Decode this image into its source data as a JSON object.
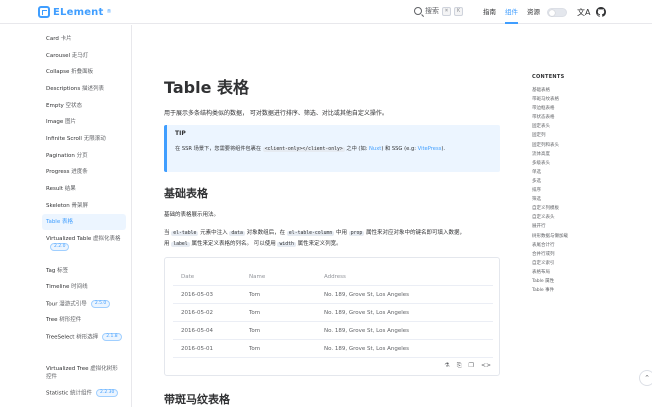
{
  "header": {
    "logo_text": "ELement",
    "logo_sup": "®",
    "search_label": "搜索",
    "kbd_keys": [
      "⌘",
      "K"
    ],
    "nav": [
      {
        "label": "指南",
        "active": false
      },
      {
        "label": "组件",
        "active": true
      },
      {
        "label": "资源",
        "active": false
      }
    ],
    "lang_icon": "文A"
  },
  "sidebar": {
    "items": [
      {
        "label": "Card",
        "sub": "卡片"
      },
      {
        "label": "Carousel",
        "sub": "走马灯"
      },
      {
        "label": "Collapse",
        "sub": "折叠面板"
      },
      {
        "label": "Descriptions",
        "sub": "描述列表"
      },
      {
        "label": "Empty",
        "sub": "空状态"
      },
      {
        "label": "Image",
        "sub": "图片"
      },
      {
        "label": "Infinite Scroll",
        "sub": "无限滚动"
      },
      {
        "label": "Pagination",
        "sub": "分页"
      },
      {
        "label": "Progress",
        "sub": "进度条"
      },
      {
        "label": "Result",
        "sub": "结果"
      },
      {
        "label": "Skeleton",
        "sub": "骨架屏"
      },
      {
        "label": "Table",
        "sub": "表格",
        "active": true
      },
      {
        "label": "Virtualized Table",
        "sub": "虚拟化表格",
        "badge": "2.2.0"
      },
      {
        "label": "Tag",
        "sub": "标签"
      },
      {
        "label": "Timeline",
        "sub": "时间线"
      },
      {
        "label": "Tour",
        "sub": "漫游式引导",
        "badge": "2.5.0"
      },
      {
        "label": "Tree",
        "sub": "树形控件"
      },
      {
        "label": "TreeSelect",
        "sub": "树形选择",
        "badge": "2.1.8"
      },
      {
        "label": "Virtualized Tree",
        "sub": "虚拟化树形控件"
      },
      {
        "label": "Statistic",
        "sub": "统计组件",
        "badge": "2.2.30"
      }
    ]
  },
  "main": {
    "title": "Table 表格",
    "intro": "用于展示多条结构类似的数据， 可对数据进行排序、筛选、对比或其他自定义操作。",
    "tip": {
      "title": "TIP",
      "text_before": "在 SSR 场景下，您需要将组件包裹在 ",
      "code": "<client-only></client-only>",
      "text_mid": " 之中 (如: ",
      "link1": "Nuxt",
      "text_mid2": ") 和 SSG (e.g: ",
      "link2": "VitePress",
      "text_after": ")."
    },
    "basic": {
      "title": "基础表格",
      "subtitle": "基础的表格展示用法。",
      "p_1": "当 ",
      "c_1": "el-table",
      "p_2": " 元素中注入 ",
      "c_2": "data",
      "p_3": " 对象数组后，在 ",
      "c_3": "el-table-column",
      "p_4": " 中用 ",
      "c_4": "prop",
      "p_5": " 属性来对应对象中的键名即可填入数据，",
      "p_6": "用 ",
      "c_5": "label",
      "p_7": " 属性来定义表格的列名。 可以使用 ",
      "c_6": "width",
      "p_8": " 属性来定义列宽。"
    },
    "table": {
      "headers": [
        "Date",
        "Name",
        "Address"
      ],
      "rows": [
        [
          "2016-05-03",
          "Tom",
          "No. 189, Grove St, Los Angeles"
        ],
        [
          "2016-05-02",
          "Tom",
          "No. 189, Grove St, Los Angeles"
        ],
        [
          "2016-05-04",
          "Tom",
          "No. 189, Grove St, Los Angeles"
        ],
        [
          "2016-05-01",
          "Tom",
          "No. 189, Grove St, Los Angeles"
        ]
      ]
    },
    "striped_title": "带斑马纹表格"
  },
  "toc": {
    "heading": "CONTENTS",
    "items": [
      "基础表格",
      "带斑马纹表格",
      "带边框表格",
      "带状态表格",
      "固定表头",
      "固定列",
      "固定列和表头",
      "流体高度",
      "多级表头",
      "单选",
      "多选",
      "排序",
      "筛选",
      "自定义列模板",
      "自定义表头",
      "展开行",
      "树形数据与懒加载",
      "表尾合计行",
      "合并行或列",
      "自定义索引",
      "表格布局",
      "Table 属性",
      "Table 事件"
    ]
  },
  "colors": {
    "accent": "#409eff",
    "tip_bg": "#ecf5ff"
  }
}
